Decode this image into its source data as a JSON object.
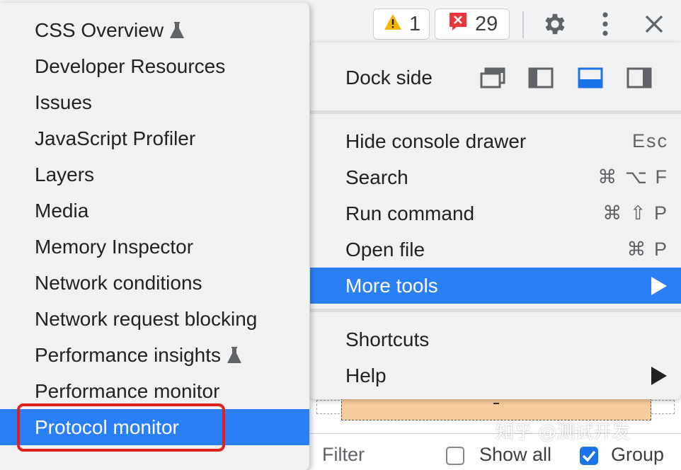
{
  "toolbar": {
    "warning_count": "1",
    "error_count": "29",
    "warning_color": "#f4b400",
    "error_color": "#e8383d"
  },
  "more_tools_submenu": {
    "items": [
      {
        "label": "CSS Overview",
        "experimental": true
      },
      {
        "label": "Developer Resources",
        "experimental": false
      },
      {
        "label": "Issues",
        "experimental": false
      },
      {
        "label": "JavaScript Profiler",
        "experimental": false
      },
      {
        "label": "Layers",
        "experimental": false
      },
      {
        "label": "Media",
        "experimental": false
      },
      {
        "label": "Memory Inspector",
        "experimental": false
      },
      {
        "label": "Network conditions",
        "experimental": false
      },
      {
        "label": "Network request blocking",
        "experimental": false
      },
      {
        "label": "Performance insights",
        "experimental": true
      },
      {
        "label": "Performance monitor",
        "experimental": false
      },
      {
        "label": "Protocol monitor",
        "experimental": false,
        "selected": true
      }
    ],
    "highlight_color": "#e0201f",
    "selected_color": "#2b7ff5"
  },
  "main_menu": {
    "dock_side_label": "Dock side",
    "dock_options": [
      "undock-icon",
      "dock-left-icon",
      "dock-bottom-icon",
      "dock-right-icon"
    ],
    "dock_selected": "dock-bottom-icon",
    "items": [
      {
        "label": "Hide console drawer",
        "shortcut": "Esc"
      },
      {
        "label": "Search",
        "shortcut": "⌘ ⌥ F"
      },
      {
        "label": "Run command",
        "shortcut": "⌘ ⇧ P"
      },
      {
        "label": "Open file",
        "shortcut": "⌘ P"
      },
      {
        "label": "More tools",
        "shortcut": "",
        "submenu": true,
        "active": true
      }
    ],
    "items2": [
      {
        "label": "Shortcuts",
        "shortcut": ""
      },
      {
        "label": "Help",
        "shortcut": "",
        "submenu": true
      }
    ]
  },
  "filter_bar": {
    "filter_label": "Filter",
    "show_all_label": "Show all",
    "group_label": "Group"
  },
  "watermark": "知乎 @测试开发"
}
